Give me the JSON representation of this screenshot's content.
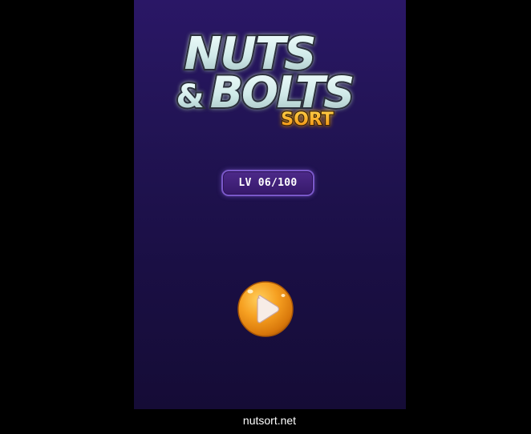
{
  "game": {
    "logo": {
      "line1": "NUTS",
      "line2_amp": "&",
      "line2_word": "BOLTS",
      "line3": "SORT",
      "icon": "nuts-and-bolts-sort-logo"
    },
    "level": {
      "label": "LV 06/100",
      "current": 6,
      "total": 100
    },
    "play_button": {
      "icon": "play-icon",
      "color": "#f39a17"
    }
  },
  "footer": {
    "url_text": "nutsort.net"
  },
  "colors": {
    "page_background": "#000000",
    "game_background_top": "#2a1766",
    "game_background_bottom": "#150c36",
    "logo_text": "#dff5f4",
    "logo_outline": "#2a2f3a",
    "logo_sort": "#f5a51c",
    "badge_fill": "#3d1f78",
    "badge_border": "#7a58c9"
  }
}
